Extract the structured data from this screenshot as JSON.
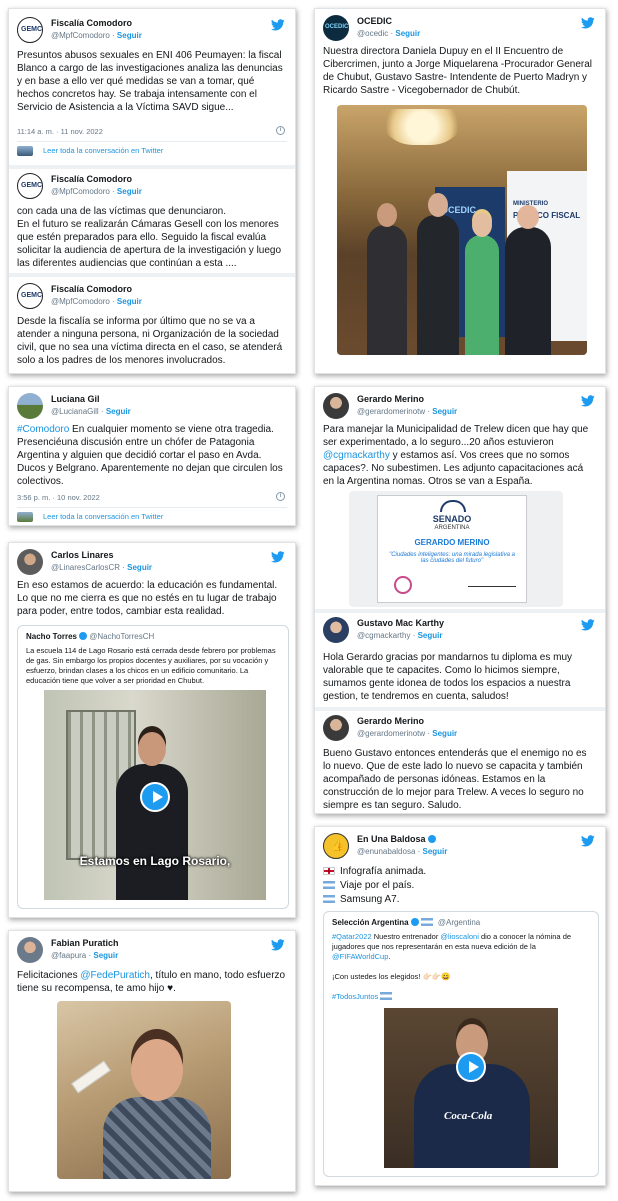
{
  "follow": "Seguir",
  "read_conversation": "Leer toda la conversación en Twitter",
  "fiscalia1": {
    "name": "Fiscalía Comodoro",
    "handle": "@MpfComodoro",
    "avatar_text": "GEMC",
    "text": "Presuntos abusos sexuales en ENI 406 Peumayen: la fiscal Blanco a cargo de las investigaciones analiza las denuncias y en base a ello ver qué medidas se van a tomar, qué hechos concretos hay. Se trabaja intensamente con el Servicio de Asistencia a la Víctima SAVD sigue...",
    "time": "11:14 a. m. · 11 nov. 2022"
  },
  "fiscalia2": {
    "name": "Fiscalía Comodoro",
    "handle": "@MpfComodoro",
    "text": "con cada una de las víctimas que denunciaron.\nEn el futuro se realizarán Cámaras Gesell con los menores que estén preparados para ello. Seguido la fiscal evalúa solicitar la audiencia de apertura de la investigación y luego las diferentes audiencias que continúan a esta ...."
  },
  "fiscalia3": {
    "name": "Fiscalía Comodoro",
    "handle": "@MpfComodoro",
    "text": "Desde la fiscalía se informa por último que no se va a atender a ninguna persona, ni Organización de la sociedad civil, que no sea una víctima directa en el caso, se atenderá solo a los padres de los menores involucrados."
  },
  "ocedic": {
    "name": "OCEDIC",
    "handle": "@ocedic",
    "avatar_text": "OCEDIC",
    "text": "Nuestra directora Daniela Dupuy en el II Encuentro de Cibercrimen, junto a Jorge Miquelarena -Procurador General de Chubut, Gustavo Sastre- Intendente de Puerto Madryn y Ricardo Sastre - Vicegobernador de Chubút.",
    "banner_left": "OCEDIC",
    "banner_right_1": "MINISTERIO",
    "banner_right_2": "PÚBLICO FISCAL"
  },
  "luciana": {
    "name": "Luciana Gil",
    "handle": "@LucianaGill",
    "hashtag": "#Comodoro",
    "text": " En cualquier momento se viene otra tragedia. Presenciéuna discusión entre un chófer de Patagonia Argentina y alguien que decidió cortar el paso en Avda. Ducos y Belgrano. Aparentemente no dejan que circulen los colectivos.",
    "time": "3:56 p. m. · 10 nov. 2022"
  },
  "merino1": {
    "name": "Gerardo Merino",
    "handle": "@gerardomerinotw",
    "text_a": "Para manejar la Municipalidad de Trelew dicen que hay que ser experimentado, a lo seguro...20 años estuvieron ",
    "mention": "@cgmackarthy",
    "text_b": " y estamos así. Vos crees que no somos capaces?. No subestimen. Les adjunto capacitaciones acá en la Argentina nomas. Otros se van a España.",
    "diploma_title": "SENADO",
    "diploma_sub": "ARGENTINA",
    "diploma_name": "GERARDO MERINO",
    "diploma_course": "\"Ciudades inteligentes: una mirada legislativa a las ciudades del futuro\""
  },
  "mackarthy": {
    "name": "Gustavo Mac Karthy",
    "handle": "@cgmackarthy",
    "text": "Hola Gerardo gracias por mandarnos tu diploma es muy valorable que te capacites. Como lo hicimos siempre, sumamos gente idonea de todos los espacios a nuestra gestion, te tendremos en cuenta, saludos!"
  },
  "merino2": {
    "name": "Gerardo Merino",
    "handle": "@gerardomerinotw",
    "text": "Bueno Gustavo entonces entenderás que el enemigo no es lo nuevo. Que de este lado lo nuevo se capacita y también acompañado de personas idóneas. Estamos en la construcción de lo mejor para Trelew. A veces lo seguro no siempre es tan seguro. Saludo."
  },
  "linares": {
    "name": "Carlos Linares",
    "handle": "@LinaresCarlosCR",
    "text": "En eso estamos de acuerdo: la educación es fundamental. Lo que no me cierra es que no estés en tu lugar de trabajo para poder, entre todos, cambiar esta realidad.",
    "quote_name": "Nacho Torres",
    "quote_handle": "@NachoTorresCH",
    "quote_text": "La escuela 114 de Lago Rosario está cerrada desde febrero por problemas de gas. Sin embargo los propios docentes y auxiliares, por su vocación y esfuerzo, brindan clases a los chicos en un edificio comunitario. La educación tiene que volver a ser prioridad en Chubut.",
    "caption": "Estamos en Lago Rosario,"
  },
  "enunabaldosa": {
    "name": "En Una Baldosa",
    "handle": "@enunabaldosa",
    "line1": "Infografía animada.",
    "line2": "Viaje por el país.",
    "line3": "Samsung A7.",
    "quote_name": "Selección Argentina",
    "quote_handle": "@Argentina",
    "quote_hashtag": "#Qatar2022",
    "quote_text_a": " Nuestro entrenador ",
    "quote_mention": "@lioscaloni",
    "quote_text_b": " dio a conocer la nómina de jugadores que nos representarán en esta nueva edición de la ",
    "quote_mention2": "@FIFAWorldCup",
    "quote_text_c": ".",
    "quote_line2": "¡Con ustedes los elegidos! 👉🏻👉🏻😀",
    "quote_hashtag2": "#TodosJuntos",
    "jersey_text": "Coca-Cola"
  },
  "puratich": {
    "name": "Fabian Puratich",
    "handle": "@faapura",
    "text_a": "Felicitaciones ",
    "mention": "@FedePuratich",
    "text_b": ", título en mano, todo esfuerzo tiene su recompensa, te amo hijo ♥."
  },
  "colors": {
    "twitter_blue": "#1d9bf0",
    "link_blue": "#1b95e0",
    "text": "#14171a",
    "muted": "#657786"
  }
}
